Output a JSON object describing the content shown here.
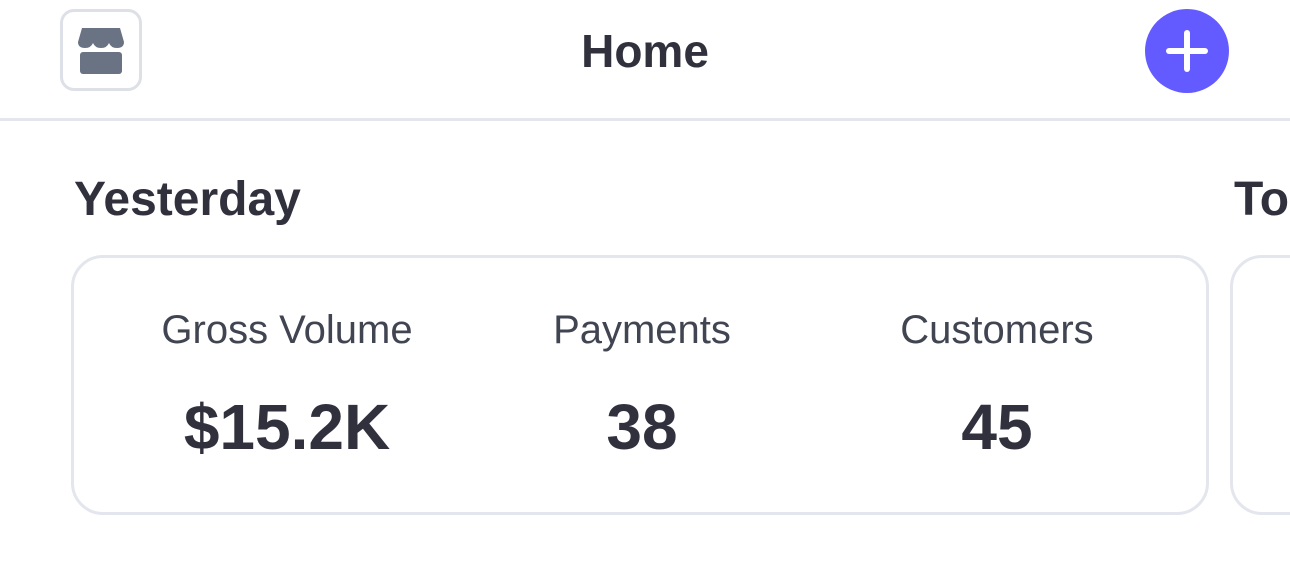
{
  "header": {
    "title": "Home",
    "store_icon": "storefront-icon",
    "add_icon": "plus-icon",
    "accent_color": "#635bff"
  },
  "sections": {
    "yesterday": {
      "title": "Yesterday",
      "metrics": [
        {
          "label": "Gross Volume",
          "value": "$15.2K"
        },
        {
          "label": "Payments",
          "value": "38"
        },
        {
          "label": "Customers",
          "value": "45"
        }
      ]
    },
    "today": {
      "title": "To"
    }
  }
}
